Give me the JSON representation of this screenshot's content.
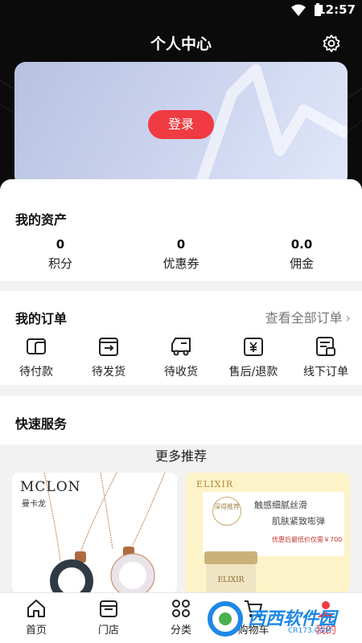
{
  "status_bar": {
    "time": "12:57"
  },
  "header": {
    "title": "个人中心",
    "settings_icon": "gear-icon"
  },
  "login_card": {
    "login_label": "登录"
  },
  "assets": {
    "title": "我的资产",
    "items": [
      {
        "value": "0",
        "label": "积分"
      },
      {
        "value": "0",
        "label": "优惠券"
      },
      {
        "value": "0.0",
        "label": "佣金"
      }
    ]
  },
  "orders": {
    "title": "我的订单",
    "view_all": "查看全部订单",
    "items": [
      {
        "label": "待付款",
        "icon": "wallet-icon"
      },
      {
        "label": "待发货",
        "icon": "box-send-icon"
      },
      {
        "label": "待收货",
        "icon": "truck-icon"
      },
      {
        "label": "售后/退款",
        "icon": "refund-icon"
      },
      {
        "label": "线下订单",
        "icon": "receipt-icon"
      }
    ]
  },
  "quick_services": {
    "title": "快速服务"
  },
  "recommend": {
    "title": "更多推荐",
    "products": [
      {
        "brand": "MCLON",
        "brand_sub": "曼卡龙"
      },
      {
        "brand": "ELIXIR",
        "badge": "深得推荐",
        "line1": "触感细腻丝滑",
        "line2": "肌肤紧致嘭弹",
        "price_note": "优惠后最低价仅需￥700",
        "jar_label": "ELIXIR"
      }
    ]
  },
  "tabbar": {
    "items": [
      {
        "label": "首页",
        "icon": "home-icon"
      },
      {
        "label": "门店",
        "icon": "store-icon"
      },
      {
        "label": "分类",
        "icon": "grid-icon"
      },
      {
        "label": "购物车",
        "icon": "cart-icon"
      },
      {
        "label": "我的",
        "icon": "user-icon"
      }
    ]
  },
  "watermark": {
    "text": "西西软件园",
    "sub": "CR173.COM"
  },
  "colors": {
    "accent": "#ef3b41",
    "header_bg": "#0b0b0b",
    "card_gradient_start": "#b8c2e0",
    "card_gradient_end": "#e1e8fb"
  }
}
